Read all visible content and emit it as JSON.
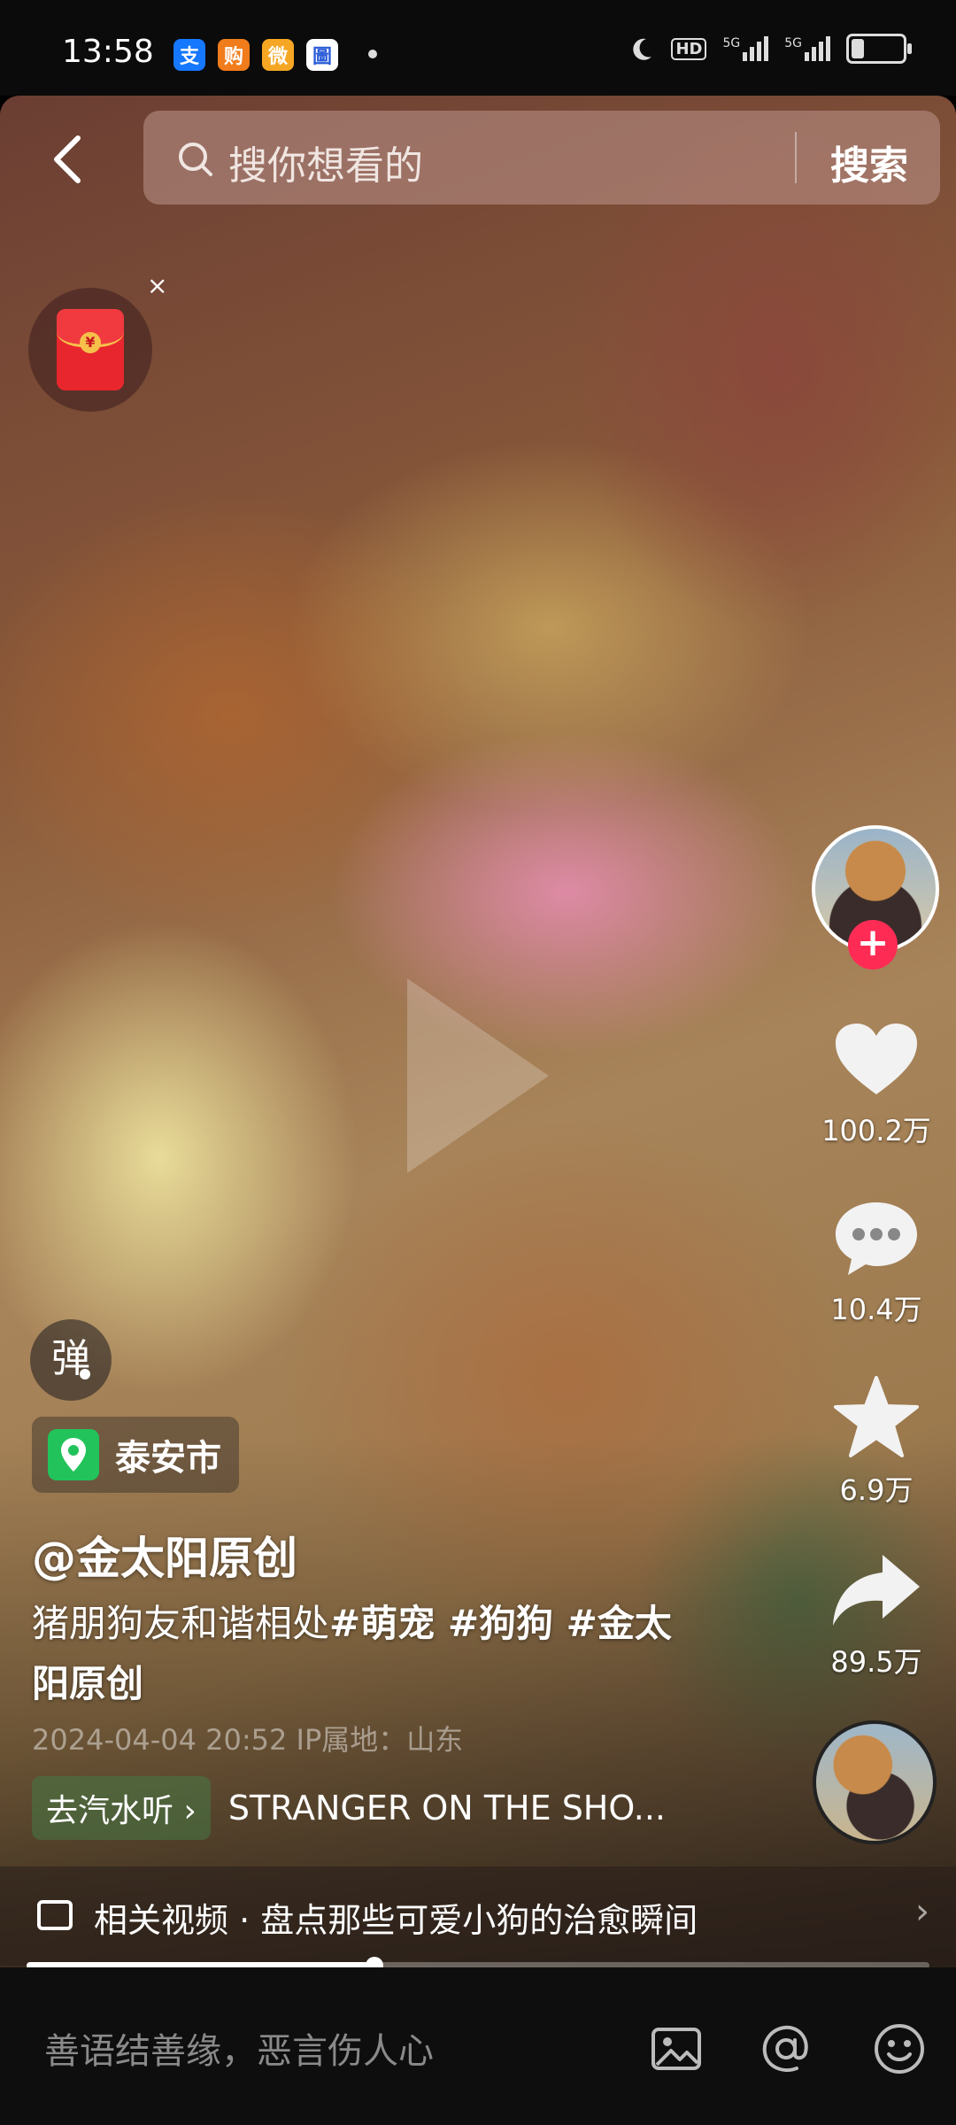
{
  "status_bar": {
    "time": "13:58",
    "apps": [
      {
        "name": "alipay-icon",
        "glyph": "支",
        "color": "#1677ff"
      },
      {
        "name": "shopping-app-icon",
        "glyph": "购",
        "color": "#f07c1b"
      },
      {
        "name": "weibo-icon",
        "glyph": "微",
        "color": "#f5a623"
      },
      {
        "name": "calendar-app-icon",
        "glyph": "圖",
        "color": "#ffffff"
      }
    ],
    "network_1": "5G",
    "network_2": "5G",
    "hd_label": "HD",
    "battery_level": 0.25
  },
  "search": {
    "placeholder": "搜你想看的",
    "button": "搜索"
  },
  "right_rail": {
    "likes": "100.2万",
    "comments": "10.4万",
    "favorites": "6.9万",
    "shares": "89.5万",
    "follow_symbol": "+"
  },
  "danmu_label": "弹",
  "location": "泰安市",
  "author": "@金太阳原创",
  "description": {
    "text": "猪朋狗友和谐相处",
    "tags": "#萌宠 #狗狗 #金太阳原创"
  },
  "meta": "2024-04-04 20:52 IP属地：山东",
  "music": {
    "chip": "去汽水听 ›",
    "title": "STRANGER ON THE SHO..."
  },
  "related": {
    "text": "相关视频 · 盘点那些可爱小狗的治愈瞬间",
    "arrow": "›"
  },
  "progress": 0.385,
  "comment_bar": {
    "placeholder": "善语结善缘，恶言伤人心"
  },
  "red_packet_close": "×"
}
